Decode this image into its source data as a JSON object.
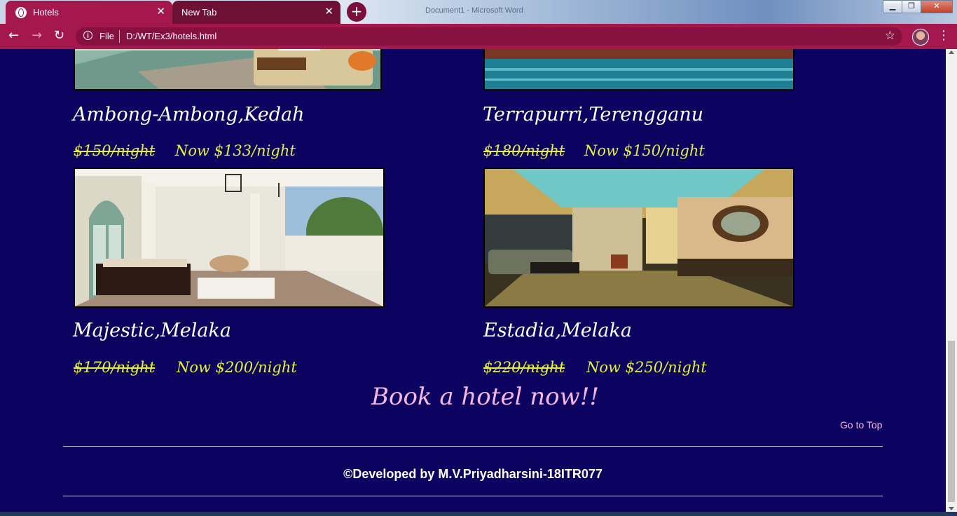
{
  "browser": {
    "tabs": [
      {
        "label": "Hotels"
      },
      {
        "label": "New Tab"
      }
    ],
    "window_title": "Document1 - Microsoft Word",
    "scheme": "File",
    "url": "D:/WT/Ex3/hotels.html",
    "colors": {
      "chrome": "#a5184e",
      "inactive_tab": "#6d1034"
    }
  },
  "page": {
    "background": "#0c0360",
    "hotels": [
      {
        "name": "Ambong-Ambong,Kedah",
        "old_price": "$150/night",
        "new_price": "Now $133/night",
        "image": "poolside lounge"
      },
      {
        "name": "Terrapurri,Terengganu",
        "old_price": "$180/night",
        "new_price": "Now $150/night",
        "image": "resort pool"
      },
      {
        "name": "Majestic,Melaka",
        "old_price": "$170/night",
        "new_price": "Now $200/night",
        "image": "colonial veranda"
      },
      {
        "name": "Estadia,Melaka",
        "old_price": "$220/night",
        "new_price": "Now $250/night",
        "image": "hotel suite"
      }
    ],
    "book_heading": "Book a hotel now!!",
    "go_to_top": "Go to Top",
    "footer": "©Developed by M.V.Priyadharsini-18ITR077",
    "price_color": "#e6ef38",
    "heading_color": "#f5b7e7"
  }
}
